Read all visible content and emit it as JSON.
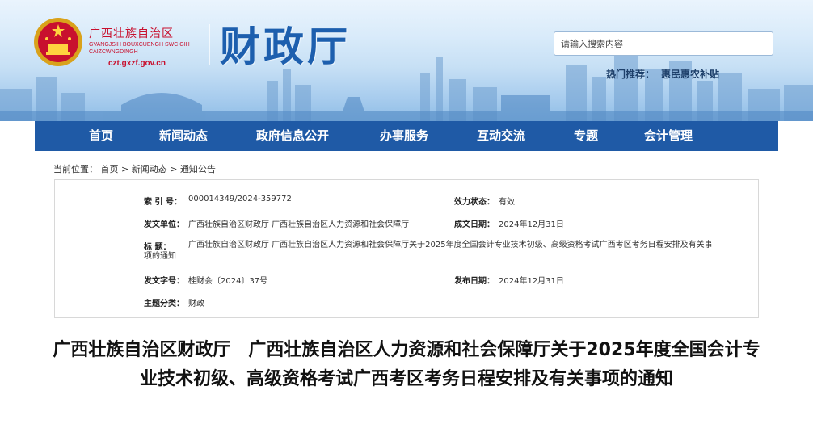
{
  "header": {
    "region_name": "广西壮族自治区",
    "region_zhuang": "GVANGJSIH BOUXCUENGH SWCIGIH CAIZCWNGDINGH",
    "url": "czt.gxzf.gov.cn",
    "site_title": "财政厅",
    "search_placeholder": "请输入搜索内容",
    "hot_label": "热门推荐：",
    "hot_link": "惠民惠农补贴"
  },
  "nav": {
    "items": [
      "首页",
      "新闻动态",
      "政府信息公开",
      "办事服务",
      "互动交流",
      "专题",
      "会计管理"
    ]
  },
  "breadcrumb": {
    "prefix": "当前位置：",
    "items": [
      "首页",
      "新闻动态",
      "通知公告"
    ],
    "separator": ">"
  },
  "info": {
    "index_label": "索 引 号：",
    "index_value": "000014349/2024-359772",
    "status_label": "效力状态：",
    "status_value": "有效",
    "issuer_label": "发文单位：",
    "issuer_value": "广西壮族自治区财政厅   广西壮族自治区人力资源和社会保障厅",
    "created_label": "成文日期：",
    "created_value": "2024年12月31日",
    "title_label": "标      题：",
    "title_value": "广西壮族自治区财政厅   广西壮族自治区人力资源和社会保障厅关于2025年度全国会计专业技术初级、高级资格考试广西考区考务日程安排及有关事项的通知",
    "docno_label": "发文字号：",
    "docno_value": "桂财会〔2024〕37号",
    "published_label": "发布日期：",
    "published_value": "2024年12月31日",
    "category_label": "主题分类：",
    "category_value": "财政"
  },
  "article": {
    "title": "广西壮族自治区财政厅　广西壮族自治区人力资源和社会保障厅关于2025年度全国会计专业技术初级、高级资格考试广西考区考务日程安排及有关事项的通知"
  },
  "colors": {
    "nav_bg": "#1f5aa6",
    "title_blue": "#1d5fae",
    "gov_red": "#c8102e"
  }
}
